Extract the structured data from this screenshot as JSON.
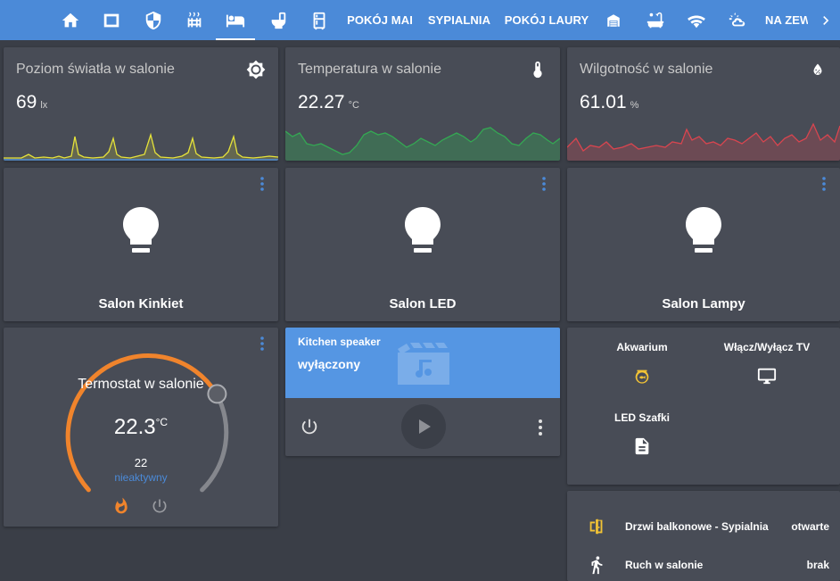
{
  "tabs": [
    {
      "icon": "home-icon",
      "active": false
    },
    {
      "icon": "square-icon",
      "active": false
    },
    {
      "icon": "shield-icon",
      "active": false
    },
    {
      "icon": "radiator-icon",
      "active": false
    },
    {
      "icon": "sofa-icon",
      "active": true
    },
    {
      "icon": "toilet-icon",
      "active": false
    },
    {
      "icon": "fridge-icon",
      "active": false
    },
    {
      "label": "POKÓJ MAI"
    },
    {
      "label": "SYPIALNIA"
    },
    {
      "label": "POKÓJ LAURY"
    },
    {
      "icon": "garage-icon",
      "active": false
    },
    {
      "icon": "bathtub-icon",
      "active": false
    },
    {
      "icon": "wifi-icon",
      "active": false
    },
    {
      "icon": "weather-icon",
      "active": false
    },
    {
      "label": "NA ZEW"
    },
    {
      "icon": "chevron-right-icon"
    }
  ],
  "sensors": [
    {
      "name": "Poziom światła w salonie",
      "value": "69",
      "unit": "lx",
      "icon": "brightness-icon",
      "color": "#e6e33a"
    },
    {
      "name": "Temperatura w salonie",
      "value": "22.27",
      "unit": "°C",
      "icon": "thermometer-icon",
      "color": "#34a853"
    },
    {
      "name": "Wilgotność w salonie",
      "value": "61.01",
      "unit": "%",
      "icon": "water-percent-icon",
      "color": "#d9454f"
    }
  ],
  "lights": [
    {
      "name": "Salon Kinkiet",
      "icon": "lightbulb-icon"
    },
    {
      "name": "Salon LED",
      "icon": "lightbulb-icon"
    },
    {
      "name": "Salon Lampy",
      "icon": "lightbulb-icon"
    }
  ],
  "thermostat": {
    "name": "Termostat w salonie",
    "current": "22.3",
    "unit": "°C",
    "target": "22",
    "state": "nieaktywny",
    "accent": "#f0842c"
  },
  "media": {
    "name": "Kitchen speaker",
    "state": "wyłączony",
    "accent": "#5596e3"
  },
  "entity_buttons": [
    {
      "name": "Akwarium",
      "icon": "fishbowl-icon",
      "icon_color": "#f2c335"
    },
    {
      "name": "Włącz/Wyłącz TV",
      "icon": "monitor-icon",
      "icon_color": "#ffffff"
    },
    {
      "name": "LED Szafki",
      "icon": "file-document-icon",
      "icon_color": "#ffffff"
    }
  ],
  "entities": [
    {
      "name": "Drzwi balkonowe - Sypialnia",
      "state": "otwarte",
      "icon": "door-open-icon",
      "icon_color": "#f2c335"
    },
    {
      "name": "Ruch w salonie",
      "state": "brak",
      "icon": "walk-icon",
      "icon_color": "#ffffff"
    }
  ]
}
